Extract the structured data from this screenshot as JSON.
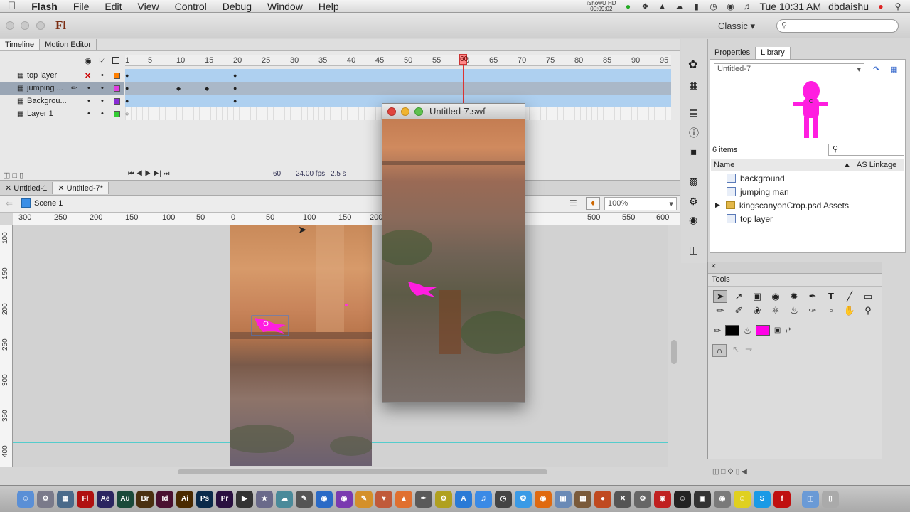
{
  "menubar": {
    "app_name": "Flash",
    "items": [
      "File",
      "Edit",
      "View",
      "Control",
      "Debug",
      "Window",
      "Help"
    ],
    "recorder": {
      "name": "iShowU HD",
      "time": "00:09:02"
    },
    "clock": "Tue 10:31 AM",
    "user": "dbdaishu"
  },
  "toolbar": {
    "app_logo": "Fl",
    "workspace": "Classic"
  },
  "timeline": {
    "tabs": [
      "Timeline",
      "Motion Editor"
    ],
    "frame_numbers": [
      "1",
      "5",
      "10",
      "15",
      "20",
      "25",
      "30",
      "35",
      "40",
      "45",
      "50",
      "55",
      "60",
      "65",
      "70",
      "75",
      "80",
      "85",
      "90",
      "95"
    ],
    "playhead_frame": "60",
    "layers": [
      {
        "name": "top layer",
        "color": "#ff7f00"
      },
      {
        "name": "jumping ...",
        "color": "#e03ee0"
      },
      {
        "name": "Backgrou...",
        "color": "#8a2bd6"
      },
      {
        "name": "Layer 1",
        "color": "#33cc33"
      }
    ],
    "status": {
      "frame": "60",
      "fps": "24.00 fps",
      "time": "2.5 s"
    }
  },
  "documents": {
    "tabs": [
      "Untitled-1",
      "Untitled-7*"
    ]
  },
  "scene": {
    "name": "Scene 1",
    "zoom": "100%"
  },
  "ruler": {
    "h": [
      "300",
      "250",
      "200",
      "150",
      "100",
      "50",
      "0",
      "50",
      "100",
      "150",
      "200",
      "500",
      "550",
      "600"
    ],
    "v": [
      "100",
      "150",
      "200",
      "250",
      "300",
      "350",
      "400"
    ]
  },
  "swf_window": {
    "title": "Untitled-7.swf"
  },
  "library": {
    "tabs": [
      "Properties",
      "Library"
    ],
    "document": "Untitled-7",
    "count": "6 items",
    "columns": {
      "name": "Name",
      "linkage": "AS Linkage"
    },
    "items": [
      "background",
      "jumping man",
      "kingscanyonCrop.psd Assets",
      "top layer"
    ]
  },
  "tools": {
    "title": "Tools"
  },
  "dock": {
    "apps": [
      "Fl",
      "Ae",
      "Au",
      "Br",
      "Id",
      "Ai",
      "Ps",
      "Pr"
    ]
  }
}
